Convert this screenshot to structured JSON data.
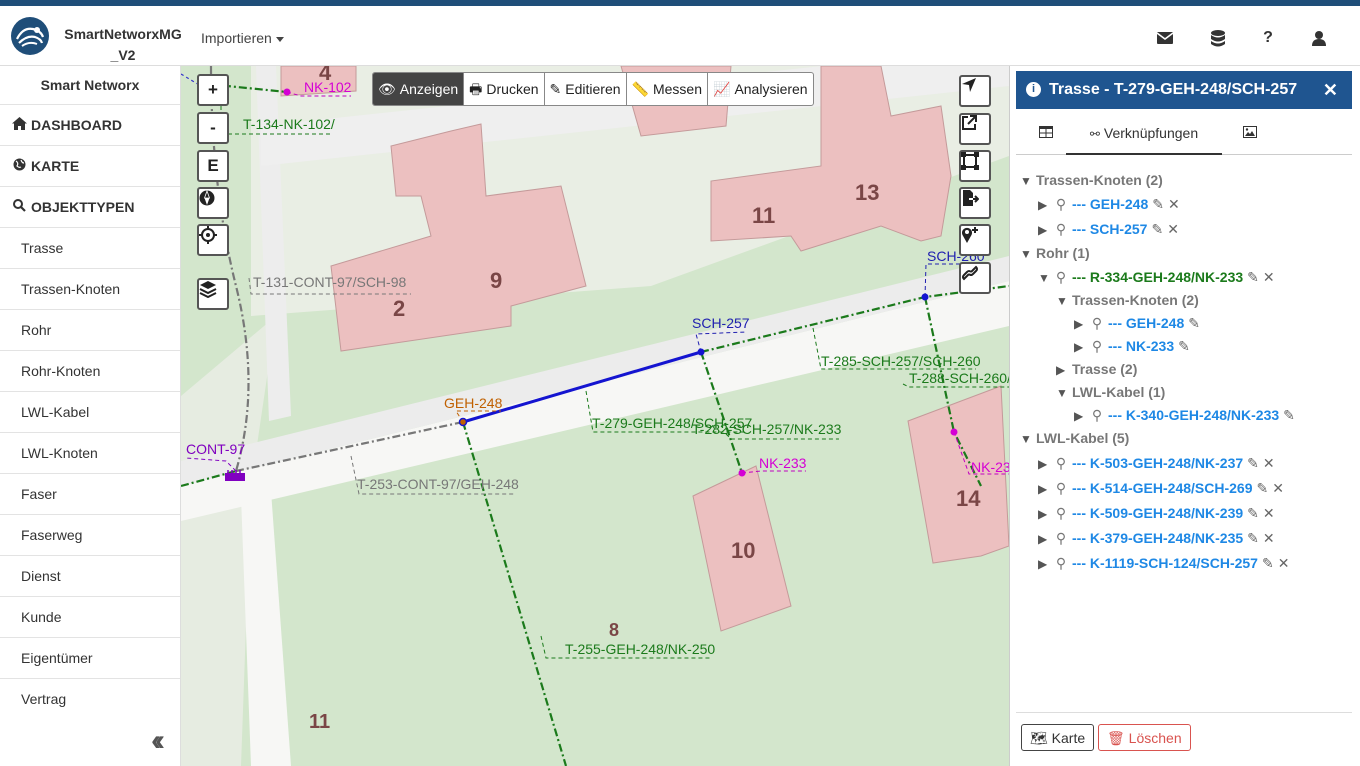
{
  "brand": {
    "line1": "SmartNetworxMG",
    "line2": "_V2"
  },
  "nav": {
    "import_label": "Importieren"
  },
  "sidebar": {
    "title": "Smart Networx",
    "main_items": [
      {
        "label": "DASHBOARD",
        "icon": "home-icon"
      },
      {
        "label": "KARTE",
        "icon": "globe-icon"
      },
      {
        "label": "OBJEKTTYPEN",
        "icon": "search-icon"
      }
    ],
    "sub_items": [
      "Trasse",
      "Trassen-Knoten",
      "Rohr",
      "Rohr-Knoten",
      "LWL-Kabel",
      "LWL-Knoten",
      "Faser",
      "Faserweg",
      "Dienst",
      "Kunde",
      "Eigentümer",
      "Vertrag"
    ]
  },
  "map": {
    "zoom_in": "+",
    "zoom_out": "-",
    "edit_btn": "E",
    "toolbar": [
      {
        "label": "Anzeigen",
        "icon": "eye-icon",
        "active": true
      },
      {
        "label": "Drucken",
        "icon": "print-icon",
        "active": false
      },
      {
        "label": "Editieren",
        "icon": "pencil-icon",
        "active": false
      },
      {
        "label": "Messen",
        "icon": "ruler-icon",
        "active": false
      },
      {
        "label": "Analysieren",
        "icon": "chart-icon",
        "active": false
      }
    ],
    "labels": {
      "nk102": "NK-102",
      "t134": "T-134-NK-102/",
      "t131": "T-131-CONT-97/SCH-98",
      "sch257": "SCH-257",
      "sch260": "SCH-260",
      "geh248": "GEH-248",
      "cont97": "CONT-97",
      "nk233": "NK-233",
      "nk23x": "NK-23",
      "t285": "T-285-SCH-257/SCH-260",
      "t288": "T-288-SCH-260/",
      "t279": "T-279-GEH-248/SCH-257",
      "t282": "T-282-SCH-257/NK-233",
      "t253": "T-253-CONT-97/GEH-248",
      "t255": "T-255-GEH-248/NK-250"
    },
    "house_numbers": [
      "4",
      "13",
      "11",
      "9",
      "2",
      "14",
      "10",
      "8",
      "11"
    ]
  },
  "panel": {
    "title": "Trasse - T-279-GEH-248/SCH-257",
    "tabs": [
      {
        "label": "",
        "icon": "table-icon"
      },
      {
        "label": "Verknüpfungen",
        "icon": "network-icon"
      },
      {
        "label": "",
        "icon": "image-icon"
      }
    ],
    "tree": {
      "g1": "Trassen-Knoten (2)",
      "g1_items": [
        "--- GEH-248",
        "--- SCH-257"
      ],
      "g2": "Rohr (1)",
      "g2_item": "--- R-334-GEH-248/NK-233",
      "g2_sub1": "Trassen-Knoten (2)",
      "g2_sub1_items": [
        "--- GEH-248",
        "--- NK-233"
      ],
      "g2_sub2": "Trasse (2)",
      "g2_sub3": "LWL-Kabel (1)",
      "g2_sub3_item": "--- K-340-GEH-248/NK-233",
      "g3": "LWL-Kabel (5)",
      "g3_items": [
        "--- K-503-GEH-248/NK-237",
        "--- K-514-GEH-248/SCH-269",
        "--- K-509-GEH-248/NK-239",
        "--- K-379-GEH-248/NK-235",
        "--- K-1119-SCH-124/SCH-257"
      ]
    },
    "footer": {
      "map_btn": "Karte",
      "delete_btn": "Löschen"
    }
  },
  "colors": {
    "brand": "#1f4e79",
    "panel_head": "#1f5590",
    "link": "#1e88e5",
    "green": "#1b7a1b",
    "danger": "#d9534f"
  }
}
